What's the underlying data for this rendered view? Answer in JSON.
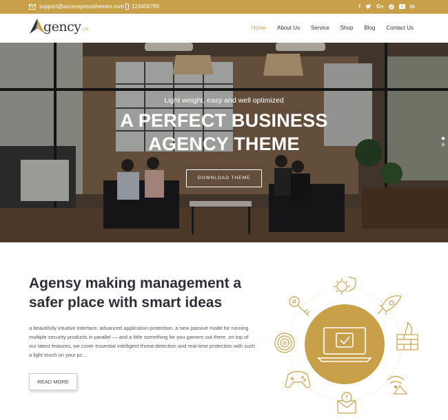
{
  "topbar": {
    "email": "support@accesspressthemes.com",
    "phone": "123456789",
    "social": [
      "f",
      "t",
      "G+",
      "p",
      "yt",
      "in"
    ],
    "social_icons": [
      "facebook-icon",
      "twitter-icon",
      "google-plus-icon",
      "pinterest-icon",
      "youtube-icon",
      "linkedin-icon"
    ]
  },
  "logo": {
    "word": "gency",
    "lite": "LITE"
  },
  "nav": {
    "items": [
      "Home",
      "About Us",
      "Service",
      "Shop",
      "Blog",
      "Contact Us"
    ],
    "active": "Home"
  },
  "hero": {
    "subtitle": "Light weight, easy and well optimized",
    "title_line1": "A PERFECT BUSINESS",
    "title_line2": "AGENCY THEME",
    "button": "DOWNLOAD THEME",
    "slides": 2,
    "active_slide": 1
  },
  "content": {
    "headline": "Agensy making management a safer place with smart ideas",
    "body": "a beautifully intuitive interface, advanced application protection, a new passive mode for running multiple security products in parallel — and a little something for you gamers out there. on top of our latest features, we cover essential intelligent threat-detection and real-time protection with such a light touch on your pc...",
    "read_more": "READ MORE"
  },
  "graphic_icons": [
    "laptop-shield-icon",
    "virus-shield-icon",
    "rocket-icon",
    "firewall-icon",
    "wifi-alert-icon",
    "envelope-alert-icon",
    "gamepad-icon",
    "fingerprint-icon",
    "key-icon"
  ],
  "colors": {
    "accent": "#c9a04a",
    "headline": "#2e2e38"
  }
}
